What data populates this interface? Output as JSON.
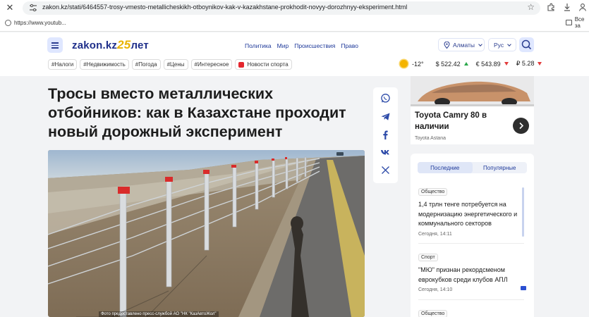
{
  "browser": {
    "url": "zakon.kz/stati/6464557-trosy-vmesto-metallicheskikh-otboynikov-kak-v-kazakhstane-prokhodit-novyy-dorozhnyy-eksperiment.html",
    "bookmark_1": "https://www.youtub...",
    "bookmark_2": "Все за"
  },
  "site": {
    "logo_text": "zakon.kz",
    "logo_num": "25",
    "logo_suffix": "лет",
    "nav": [
      "Политика",
      "Мир",
      "Происшествия",
      "Право"
    ],
    "city": "Алматы",
    "lang": "Рус",
    "tags": [
      "#Налоги",
      "#Недвижимость",
      "#Погода",
      "#Цены",
      "#Интересное"
    ],
    "sport_tag": "Новости спорта",
    "weather": "-12°",
    "usd": "$ 522.42",
    "eur": "€ 543.89",
    "rub": "₽ 5.28"
  },
  "article": {
    "title": "Тросы вместо металлических отбойников: как в Казахстане проходит новый дорожный эксперимент",
    "photo_caption": "Фото предоставлено пресс-службой АО \"НК \"КазАвтоЖол\""
  },
  "ad": {
    "title": "Toyota Camry 80 в наличии",
    "source": "Toyota Astana"
  },
  "news": {
    "tab_latest": "Последние",
    "tab_popular": "Популярные",
    "items": [
      {
        "category": "Общество",
        "title": "1,4 трлн тенге потребуется на модернизацию энергетического и коммунального секторов",
        "time": "Сегодня, 14:11"
      },
      {
        "category": "Спорт",
        "title": "\"МЮ\" признан рекордсменом еврокубков среди клубов АПЛ",
        "time": "Сегодня, 14:10"
      },
      {
        "category": "Общество"
      }
    ]
  },
  "colors": {
    "brand": "#1f2f8a",
    "accent": "#e9b300",
    "link": "#1f3a9a",
    "sport": "#e4262e"
  }
}
